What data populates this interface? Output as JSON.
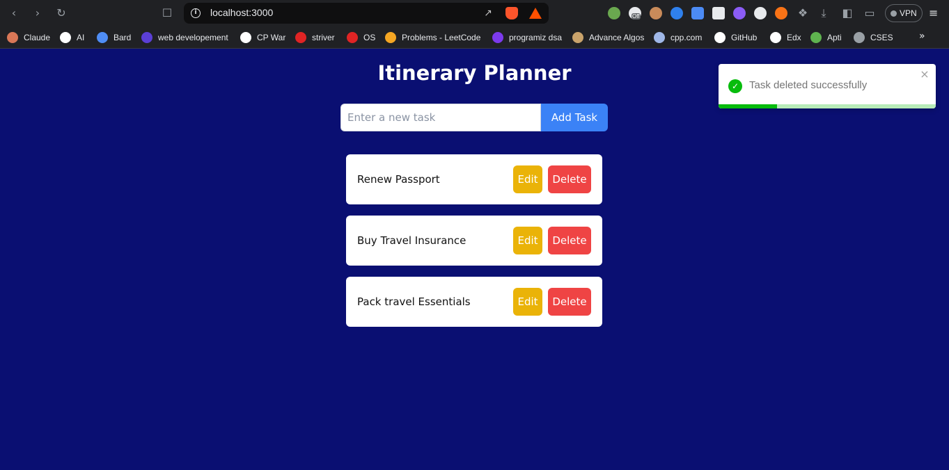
{
  "browser": {
    "url": "localhost:3000",
    "vpn_label": "VPN",
    "ext_badge": "Off",
    "bookmarks": [
      {
        "label": "Claude",
        "color": "#d97757"
      },
      {
        "label": "AI",
        "color": "#ffffff"
      },
      {
        "label": "Bard",
        "color": "#4f8df5"
      },
      {
        "label": "web developement",
        "color": "#5b3fd6"
      },
      {
        "label": "CP War",
        "color": "#ffffff"
      },
      {
        "label": "striver",
        "color": "#e02424"
      },
      {
        "label": "OS",
        "color": "#e02424"
      },
      {
        "label": "Problems - LeetCode",
        "color": "#f5a623"
      },
      {
        "label": "programiz dsa",
        "color": "#7c3aed"
      },
      {
        "label": "Advance Algos",
        "color": "#c9a36b"
      },
      {
        "label": "cpp.com",
        "color": "#9fb7e8"
      },
      {
        "label": "GitHub",
        "color": "#ffffff"
      },
      {
        "label": "Edx",
        "color": "#ffffff"
      },
      {
        "label": "Apti",
        "color": "#5fb34f"
      },
      {
        "label": "CSES",
        "color": "#9aa0a6"
      }
    ]
  },
  "app": {
    "title": "Itinerary Planner",
    "input_placeholder": "Enter a new task",
    "input_value": "",
    "add_label": "Add Task",
    "tasks": [
      {
        "label": "Renew Passport",
        "edit": "Edit",
        "delete": "Delete"
      },
      {
        "label": "Buy Travel Insurance",
        "edit": "Edit",
        "delete": "Delete"
      },
      {
        "label": "Pack travel Essentials",
        "edit": "Edit",
        "delete": "Delete"
      }
    ]
  },
  "toast": {
    "message": "Task deleted successfully",
    "close": "×",
    "progress_fraction": 0.27
  },
  "colors": {
    "background": "#0a0f72",
    "primary": "#3b82f6",
    "edit": "#eab308",
    "delete": "#ef4444",
    "success": "#07bc0c"
  }
}
